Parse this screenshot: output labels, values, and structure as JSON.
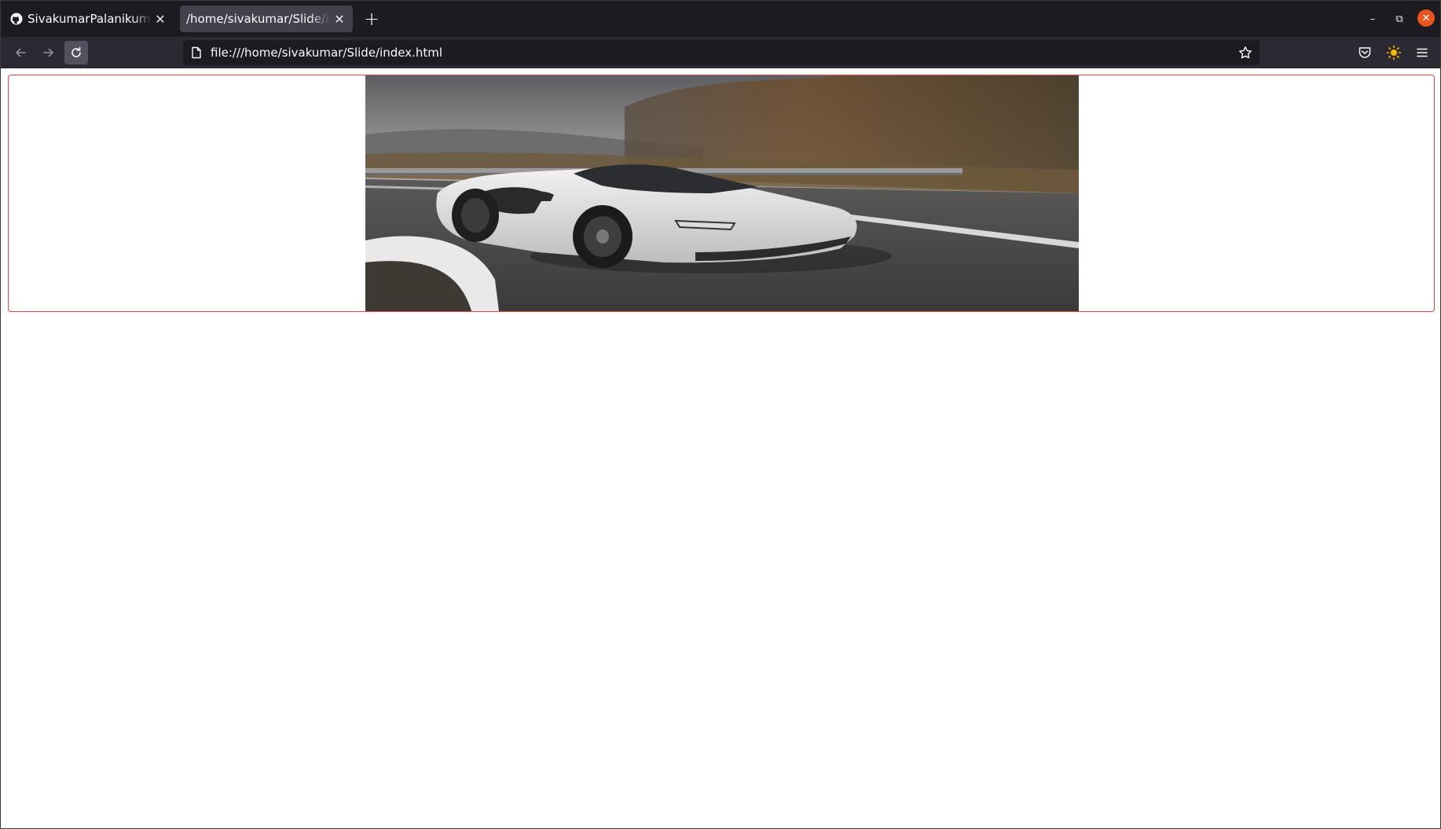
{
  "browser": {
    "tabs": [
      {
        "title": "SivakumarPalanikumarC/",
        "icon": "github-icon",
        "active": false
      },
      {
        "title": "/home/sivakumar/Slide/index.html",
        "icon": "none",
        "active": true
      }
    ],
    "new_tab_label": "+",
    "url": "file:///home/sivakumar/Slide/index.html",
    "window_controls": {
      "minimize": "–",
      "maximize": "⧉",
      "close": "✕"
    },
    "accent_close_color": "#e95420"
  },
  "page": {
    "slide": {
      "image_subject": "white sports car on a curved mountain road",
      "border_color": "#e8404a"
    }
  }
}
